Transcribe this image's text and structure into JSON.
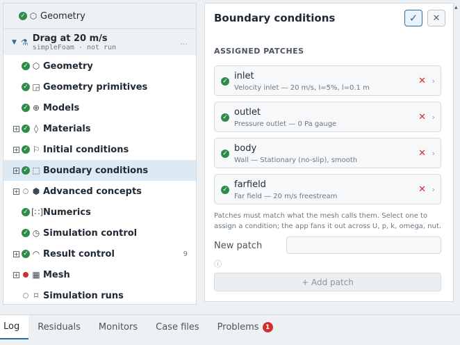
{
  "tree": {
    "root": {
      "label": "Geometry"
    },
    "case": {
      "title": "Drag at 20 m/s",
      "subtitle": "simpleFoam · not run",
      "more": "…"
    },
    "items": [
      {
        "label": "Geometry",
        "status": "ok",
        "icon": "cube-icon",
        "glyph": "⬡",
        "expandable": false
      },
      {
        "label": "Geometry primitives",
        "status": "ok",
        "icon": "shapes-icon",
        "glyph": "◲",
        "expandable": false
      },
      {
        "label": "Models",
        "status": "ok",
        "icon": "globe-icon",
        "glyph": "⊕",
        "expandable": false
      },
      {
        "label": "Materials",
        "status": "ok",
        "icon": "droplet-icon",
        "glyph": "◊",
        "expandable": true
      },
      {
        "label": "Initial conditions",
        "status": "ok",
        "icon": "flag-icon",
        "glyph": "⚐",
        "expandable": true
      },
      {
        "label": "Boundary conditions",
        "status": "ok",
        "icon": "boundary-icon",
        "glyph": "⬚",
        "expandable": true,
        "selected": true
      },
      {
        "label": "Advanced concepts",
        "status": "empty",
        "icon": "hexagon-gear-icon",
        "glyph": "⬢",
        "expandable": true
      },
      {
        "label": "Numerics",
        "status": "ok",
        "icon": "bracket-icon",
        "glyph": "[∷]",
        "expandable": false
      },
      {
        "label": "Simulation control",
        "status": "ok",
        "icon": "clock-icon",
        "glyph": "◷",
        "expandable": false
      },
      {
        "label": "Result control",
        "status": "ok",
        "icon": "gauge-icon",
        "glyph": "◠",
        "expandable": true,
        "badge": "9"
      },
      {
        "label": "Mesh",
        "status": "error",
        "icon": "grid-icon",
        "glyph": "▦",
        "expandable": true
      },
      {
        "label": "Simulation runs",
        "status": "empty",
        "icon": "runs-icon",
        "glyph": "⌑",
        "expandable": false
      }
    ]
  },
  "panel": {
    "title": "Boundary conditions",
    "confirm": "✓",
    "close": "✕",
    "section": "ASSIGNED PATCHES",
    "patches": [
      {
        "name": "inlet",
        "desc": "Velocity inlet — 20 m/s, I=5%, l=0.1 m"
      },
      {
        "name": "outlet",
        "desc": "Pressure outlet — 0 Pa gauge"
      },
      {
        "name": "body",
        "desc": "Wall — Stationary (no-slip), smooth"
      },
      {
        "name": "farfield",
        "desc": "Far field — 20 m/s freestream"
      }
    ],
    "help": "Patches must match what the mesh calls them. Select one to assign a condition; the app fans it out across U, p, k, omega, nut.",
    "new_patch_label": "New patch",
    "new_patch_value": "",
    "add_label": "+ Add patch"
  },
  "tabs": [
    {
      "label": "Log",
      "active": true
    },
    {
      "label": "Residuals"
    },
    {
      "label": "Monitors"
    },
    {
      "label": "Case files"
    },
    {
      "label": "Problems",
      "badge": "1"
    }
  ]
}
